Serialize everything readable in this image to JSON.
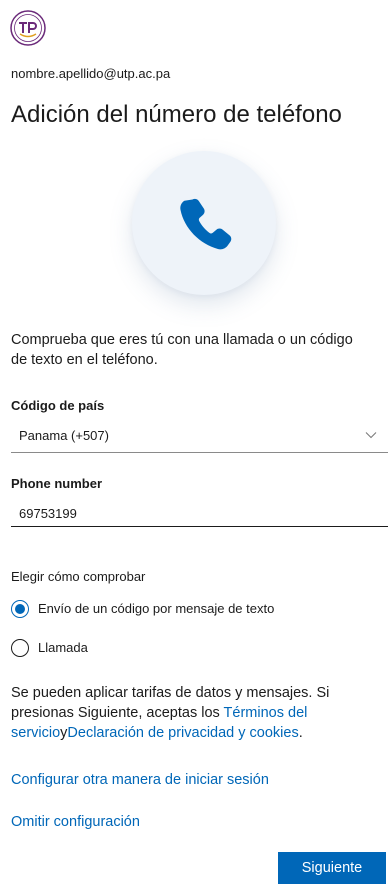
{
  "header": {
    "account": "nombre.apellido@utp.ac.pa",
    "title": "Adición del número de teléfono"
  },
  "icons": {
    "logo": "utp-seal-logo",
    "hero": "phone-icon",
    "dropdown": "chevron-down-icon"
  },
  "description": "Comprueba que eres tú con una llamada o un código de texto en el teléfono.",
  "country": {
    "label": "Código de país",
    "selected": "Panama (+507)"
  },
  "phone": {
    "label": "Phone number",
    "value": "69753199"
  },
  "verify": {
    "label": "Elegir cómo comprobar",
    "options": [
      {
        "label": "Envío de un código por mensaje de texto",
        "selected": true
      },
      {
        "label": "Llamada",
        "selected": false
      }
    ]
  },
  "terms": {
    "text_before": "Se pueden aplicar tarifas de datos y mensajes. Si presionas Siguiente, aceptas los ",
    "terms_link": "Términos del servicio",
    "joiner": "y",
    "privacy_link": "Declaración de privacidad y cookies",
    "text_after": "."
  },
  "links": {
    "other_method": "Configurar otra manera de iniciar sesión",
    "skip": "Omitir configuración"
  },
  "actions": {
    "next": "Siguiente"
  },
  "colors": {
    "accent": "#0067b8",
    "text": "#1b1b1b",
    "hero_circle": "#eef3f9"
  }
}
